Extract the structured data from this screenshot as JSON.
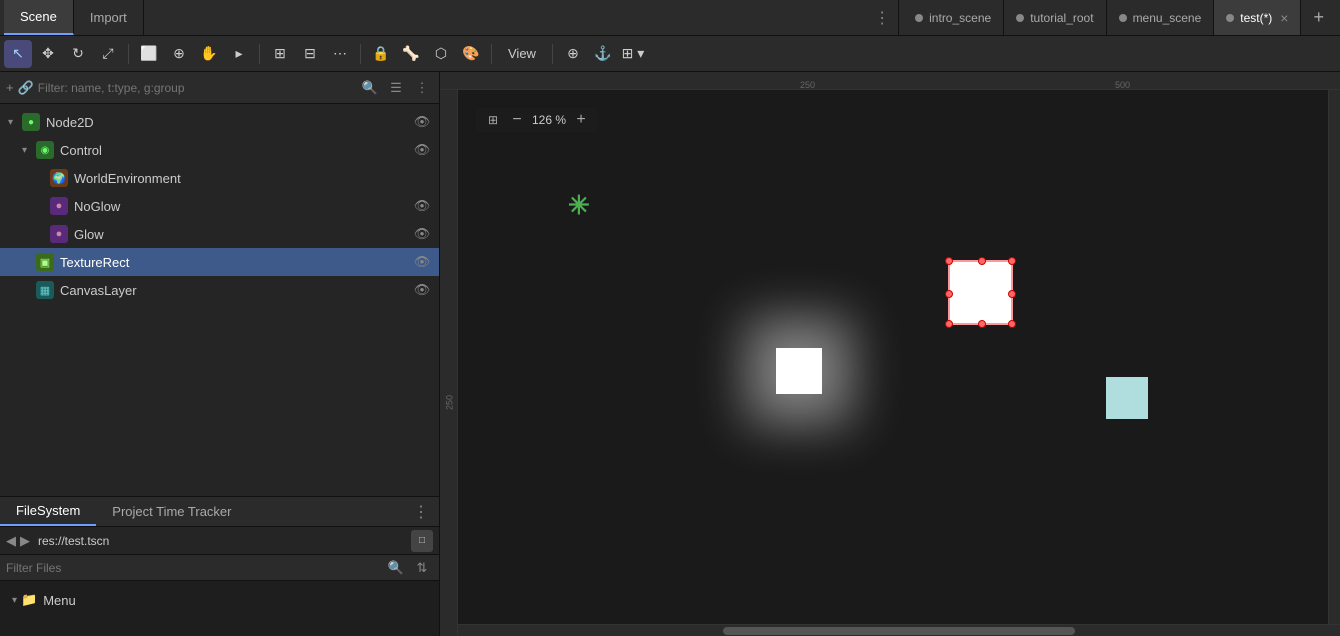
{
  "tabs": {
    "items": [
      {
        "label": "intro_scene",
        "active": false,
        "dot_color": "#888"
      },
      {
        "label": "tutorial_root",
        "active": false,
        "dot_color": "#888"
      },
      {
        "label": "menu_scene",
        "active": false,
        "dot_color": "#888"
      },
      {
        "label": "test(*)",
        "active": true,
        "dot_color": "#888",
        "closeable": true
      }
    ],
    "add_label": "+"
  },
  "toolbar": {
    "tools": [
      {
        "id": "select",
        "icon": "↖",
        "active": true
      },
      {
        "id": "move",
        "icon": "✥",
        "active": false
      },
      {
        "id": "rotate",
        "icon": "↻",
        "active": false
      },
      {
        "id": "scale",
        "icon": "⤢",
        "active": false
      },
      {
        "id": "rect-select",
        "icon": "⬜",
        "active": false
      },
      {
        "id": "pivot",
        "icon": "⊕",
        "active": false
      },
      {
        "id": "pan",
        "icon": "✋",
        "active": false
      },
      {
        "id": "ruler",
        "icon": "📐",
        "active": false
      }
    ],
    "tools2": [
      {
        "id": "lock",
        "icon": "⊞",
        "active": false
      },
      {
        "id": "group",
        "icon": "⊟",
        "active": false
      },
      {
        "id": "snap",
        "icon": "⬛",
        "active": false
      },
      {
        "id": "more",
        "icon": "⋯",
        "active": false
      }
    ],
    "tools3": [
      {
        "id": "lock2",
        "icon": "🔒",
        "active": false
      },
      {
        "id": "bone",
        "icon": "🦴",
        "active": false
      },
      {
        "id": "polygon",
        "icon": "⬡",
        "active": false
      },
      {
        "id": "paint",
        "icon": "🎨",
        "active": false
      }
    ],
    "view_label": "View",
    "zoom_add": "⊕",
    "anchor": "⚓",
    "grid": "⊞"
  },
  "panel": {
    "scene_tab": "Scene",
    "import_tab": "Import",
    "filter_placeholder": "Filter: name, t:type, g:group",
    "tree_nodes": [
      {
        "label": "Node2D",
        "indent": 0,
        "icon_type": "green",
        "icon_char": "●",
        "expandable": true,
        "eye": true,
        "has_arrow": true
      },
      {
        "label": "Control",
        "indent": 1,
        "icon_type": "green",
        "icon_char": "◉",
        "expandable": true,
        "eye": true,
        "has_arrow": true
      },
      {
        "label": "WorldEnvironment",
        "indent": 2,
        "icon_type": "orange",
        "icon_char": "🌍",
        "expandable": false,
        "eye": false,
        "has_arrow": false
      },
      {
        "label": "NoGlow",
        "indent": 2,
        "icon_type": "purple",
        "icon_char": "●",
        "expandable": false,
        "eye": true,
        "has_arrow": false
      },
      {
        "label": "Glow",
        "indent": 2,
        "icon_type": "purple",
        "icon_char": "●",
        "expandable": false,
        "eye": true,
        "has_arrow": false
      },
      {
        "label": "TextureRect",
        "indent": 1,
        "icon_type": "yellow",
        "icon_char": "▣",
        "expandable": false,
        "eye": true,
        "has_arrow": false,
        "selected": true
      },
      {
        "label": "CanvasLayer",
        "indent": 1,
        "icon_type": "teal",
        "icon_char": "▦",
        "expandable": false,
        "eye": true,
        "has_arrow": false
      }
    ]
  },
  "bottom_panel": {
    "tab1": "FileSystem",
    "tab2": "Project Time Tracker",
    "path_label": "res://test.tscn",
    "filter_placeholder": "Filter Files",
    "folder_items": [
      {
        "label": "Menu",
        "indent": 0
      }
    ]
  },
  "viewport": {
    "zoom_label": "126 %",
    "zoom_minus": "−",
    "zoom_plus": "+",
    "ruler_marks_h": [
      "250",
      "500"
    ],
    "ruler_mark_v": "250"
  }
}
